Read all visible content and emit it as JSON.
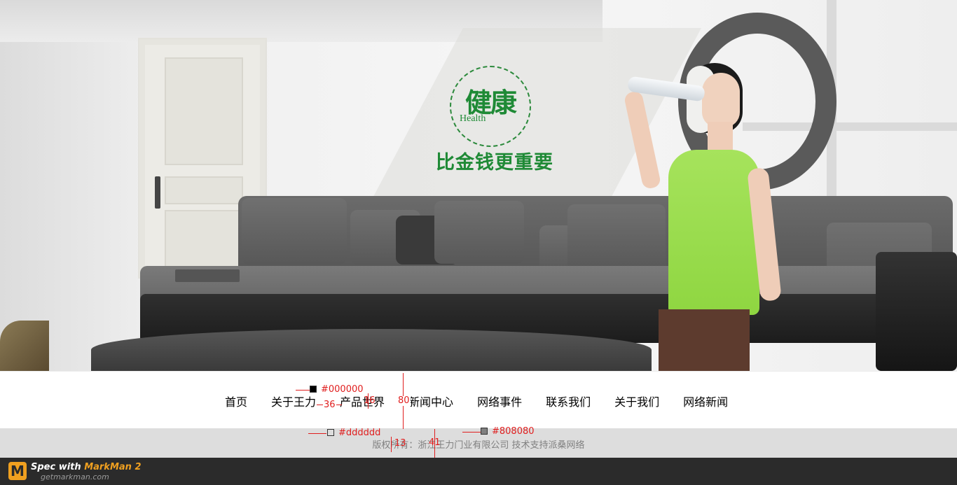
{
  "hero": {
    "badge_big": "健康",
    "badge_small": "Health",
    "slogan": "比金钱更重要",
    "accent_color": "#1f8a36"
  },
  "nav": {
    "items": [
      "首页",
      "关于王力",
      "产品世界",
      "新闻中心",
      "网络事件",
      "联系我们",
      "关于我们",
      "网络新闻"
    ]
  },
  "footer": {
    "copyright": "版权所有：浙江王力门业有限公司 技术支持派桑网络",
    "bg_color": "#dddddd",
    "text_color": "#808080"
  },
  "annotations": {
    "nav_text_color": "#000000",
    "nav_width_label": "36",
    "nav_font_size_label": "16",
    "nav_height_label": "80",
    "footer_bg_label": "#dddddd",
    "footer_font_size_label": "13",
    "footer_height_label": "41",
    "footer_text_color_label": "#808080"
  },
  "markman": {
    "title_prefix": "Spec with ",
    "title_accent": "MarkMan 2",
    "url": "getmarkman.com",
    "logo_letter": "M"
  }
}
